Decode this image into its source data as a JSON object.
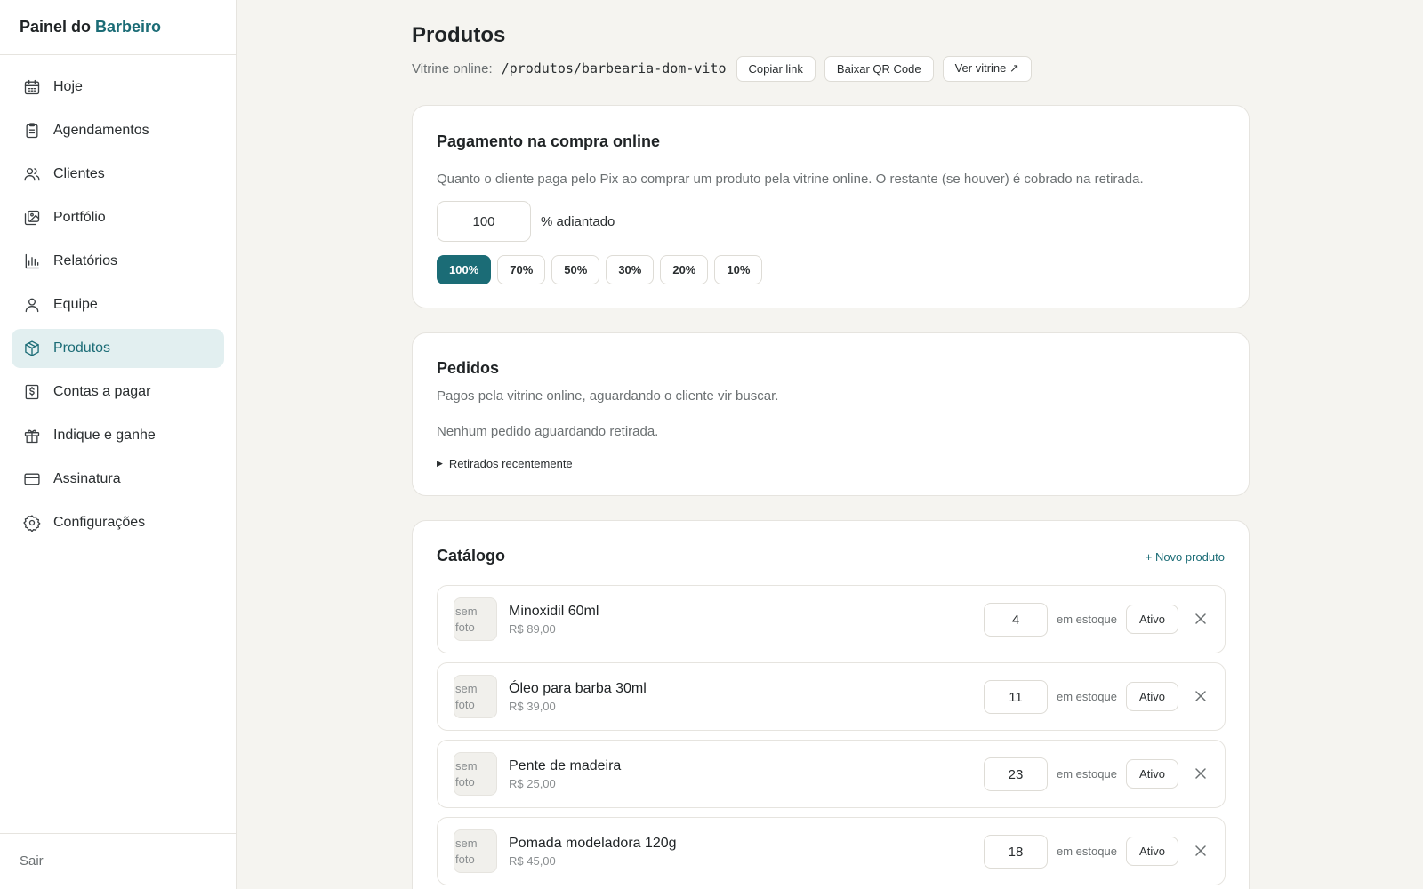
{
  "sidebar": {
    "brand_prefix": "Painel do",
    "brand_accent": "Barbeiro",
    "items": [
      {
        "label": "Hoje",
        "icon": "calendar-icon"
      },
      {
        "label": "Agendamentos",
        "icon": "clipboard-icon"
      },
      {
        "label": "Clientes",
        "icon": "users-icon"
      },
      {
        "label": "Portfólio",
        "icon": "images-icon"
      },
      {
        "label": "Relatórios",
        "icon": "bar-chart-icon"
      },
      {
        "label": "Equipe",
        "icon": "user-icon"
      },
      {
        "label": "Produtos",
        "icon": "box-icon",
        "active": true
      },
      {
        "label": "Contas a pagar",
        "icon": "receipt-icon"
      },
      {
        "label": "Indique e ganhe",
        "icon": "gift-icon"
      },
      {
        "label": "Assinatura",
        "icon": "credit-card-icon"
      },
      {
        "label": "Configurações",
        "icon": "gear-icon"
      }
    ],
    "logout": "Sair"
  },
  "header": {
    "title": "Produtos",
    "vitrine_label": "Vitrine online:",
    "vitrine_path": "/produtos/barbearia-dom-vito",
    "copy_link": "Copiar link",
    "download_qr": "Baixar QR Code",
    "view_store": "Ver vitrine ↗"
  },
  "payment": {
    "title": "Pagamento na compra online",
    "description": "Quanto o cliente paga pelo Pix ao comprar um produto pela vitrine online. O restante (se houver) é cobrado na retirada.",
    "value": "100",
    "suffix": "% adiantado",
    "presets": [
      "100%",
      "70%",
      "50%",
      "30%",
      "20%",
      "10%"
    ],
    "selected": "100%"
  },
  "orders": {
    "title": "Pedidos",
    "subtitle": "Pagos pela vitrine online, aguardando o cliente vir buscar.",
    "empty": "Nenhum pedido aguardando retirada.",
    "recent_toggle": "Retirados recentemente"
  },
  "catalog": {
    "title": "Catálogo",
    "new_product": "+ Novo produto",
    "thumb_line1": "sem",
    "thumb_line2": "foto",
    "stock_label": "em estoque",
    "products": [
      {
        "name": "Minoxidil 60ml",
        "price": "R$ 89,00",
        "stock": "4",
        "status": "Ativo"
      },
      {
        "name": "Óleo para barba 30ml",
        "price": "R$ 39,00",
        "stock": "11",
        "status": "Ativo"
      },
      {
        "name": "Pente de madeira",
        "price": "R$ 25,00",
        "stock": "23",
        "status": "Ativo"
      },
      {
        "name": "Pomada modeladora 120g",
        "price": "R$ 45,00",
        "stock": "18",
        "status": "Ativo"
      }
    ]
  },
  "colors": {
    "accent": "#1b6c76",
    "active_bg": "#e2eff0",
    "page_bg": "#f5f4f0"
  }
}
